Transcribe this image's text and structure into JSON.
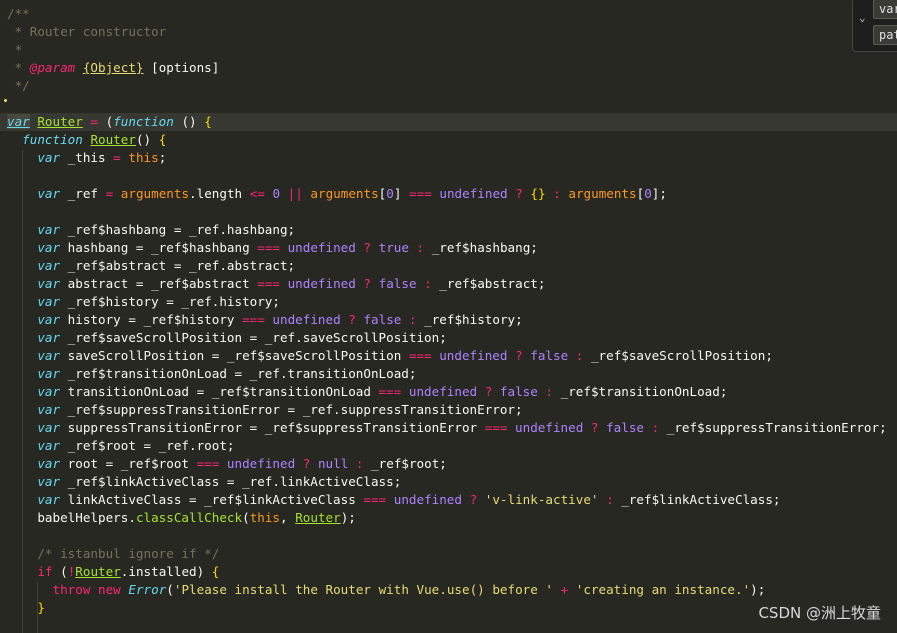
{
  "editor": {
    "comment": {
      "open": "/**",
      "line_router": " * Router constructor",
      "line_blank": " *",
      "param_tag": "@param",
      "param_type": "{Object}",
      "param_name": "[options]",
      "close": " */"
    },
    "var_router": {
      "kw": "var",
      "name": "Router",
      "eq": " = (",
      "fn": "function",
      "rest": " () {"
    },
    "fn_router": {
      "kw": "function",
      "name": "Router",
      "rest": "() {"
    },
    "this_line": {
      "kw": "var",
      "name": " _this ",
      "eq": "=",
      "this": "this",
      "end": ";"
    },
    "ref_line": "_ref",
    "options_lines": [
      {
        "name": "hashbang",
        "default": "true"
      },
      {
        "name": "abstract",
        "default": "false"
      },
      {
        "name": "history",
        "default": "false"
      },
      {
        "name": "saveScrollPosition",
        "default": "false"
      },
      {
        "name": "transitionOnLoad",
        "default": "false"
      },
      {
        "name": "suppressTransitionError",
        "default": "false"
      },
      {
        "name": "root",
        "default": "null"
      },
      {
        "name": "linkActiveClass",
        "default": "'v-link-active'"
      }
    ],
    "class_call_check": {
      "obj": "babelHelpers",
      "method": "classCallCheck",
      "arg1": "this",
      "arg2": "Router"
    },
    "istanbul_comment": "/* istanbul ignore if */",
    "if_line": {
      "kw": "if",
      "negate": "!",
      "obj": "Router",
      "prop": ".installed"
    },
    "throw_line": {
      "kw": "throw",
      "new": "new",
      "ctor": "Error",
      "msg1": "'Please install the Router with Vue.use() before '",
      "msg2": "'creating an instance.'"
    }
  },
  "hover_widget": {
    "item1": "var",
    "item2": "path"
  },
  "watermark": "CSDN @洲上牧童"
}
